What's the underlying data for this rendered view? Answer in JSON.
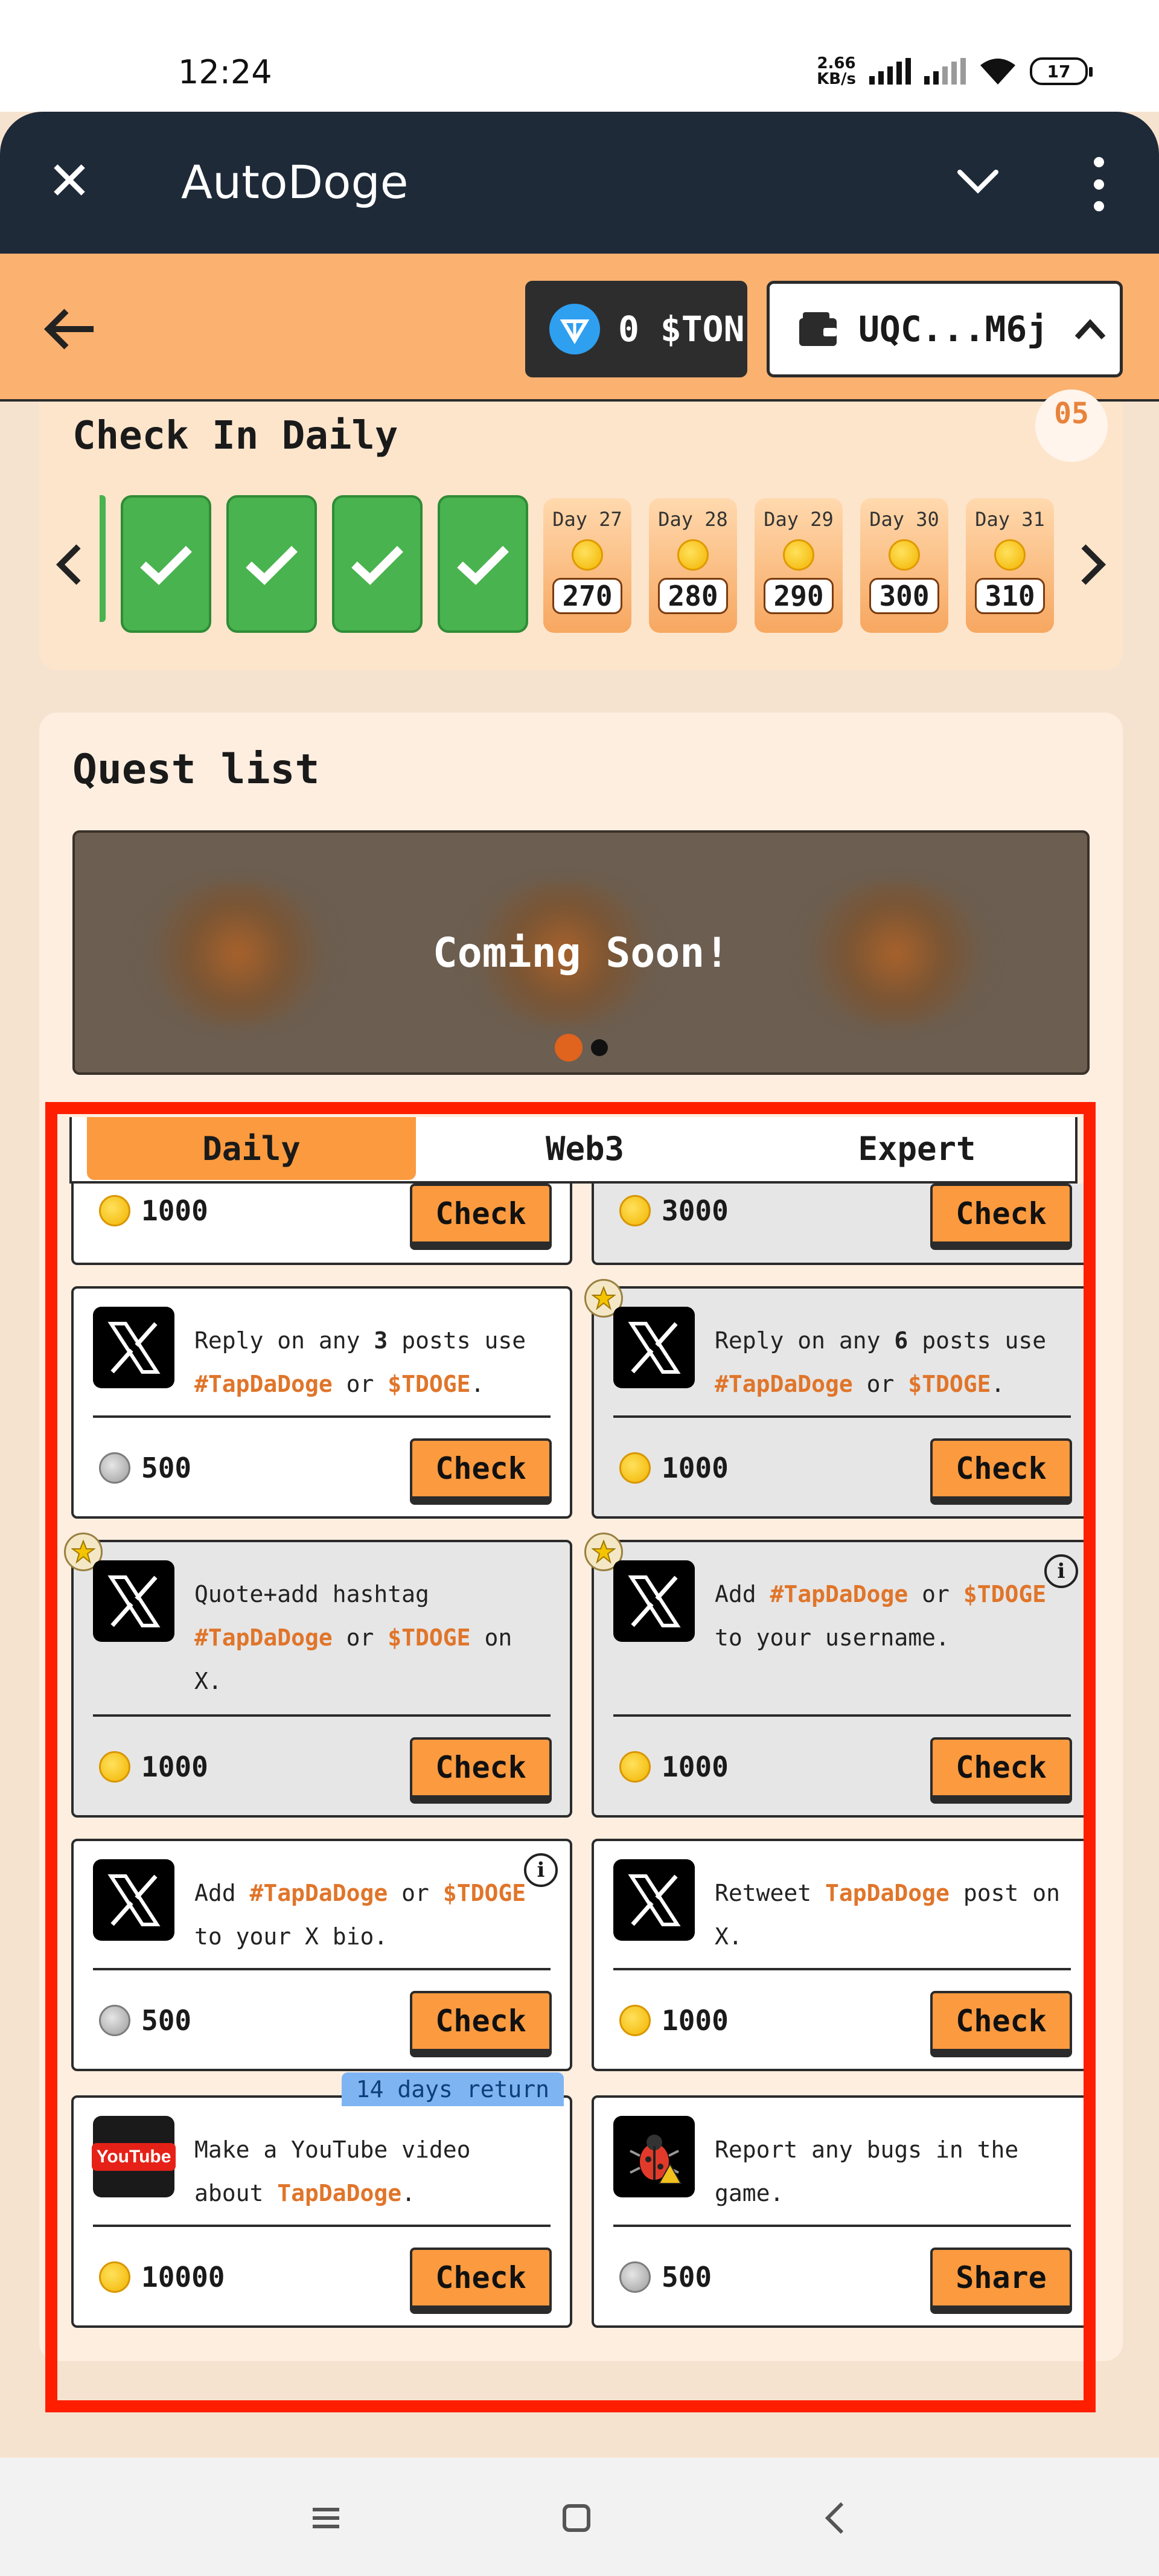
{
  "status": {
    "time": "12:24",
    "netspeed_top": "2.66",
    "netspeed_bottom": "KB/s",
    "battery": "17"
  },
  "app": {
    "title": "AutoDoge"
  },
  "header": {
    "ton_balance": "0 $TON",
    "wallet": "UQC...M6j"
  },
  "checkin": {
    "title": "Check In Daily",
    "bonus_badge": "05",
    "days": [
      {
        "label": "Day 27",
        "value": "270"
      },
      {
        "label": "Day 28",
        "value": "280"
      },
      {
        "label": "Day 29",
        "value": "290"
      },
      {
        "label": "Day 30",
        "value": "300"
      },
      {
        "label": "Day 31",
        "value": "310"
      }
    ]
  },
  "quests": {
    "title": "Quest list",
    "banner_text": "Coming Soon!",
    "tabs": [
      "Daily",
      "Web3",
      "Expert"
    ],
    "top_partial": [
      {
        "reward": "1000",
        "button": "Check"
      },
      {
        "reward": "3000",
        "button": "Check"
      }
    ],
    "cards": [
      {
        "text_before": "Reply on any ",
        "strong": "3",
        "text_mid": " posts use ",
        "tag1": "#TapDaDoge",
        "join": " or ",
        "tag2": "$TDOGE",
        "text_after": ".",
        "reward": "500",
        "button": "Check"
      },
      {
        "text_before": "Reply on any ",
        "strong": "6",
        "text_mid": " posts use ",
        "tag1": "#TapDaDoge",
        "join": " or ",
        "tag2": "$TDOGE",
        "text_after": ".",
        "reward": "1000",
        "button": "Check"
      },
      {
        "text_before": "Quote+add hashtag ",
        "tag1": "#TapDaDoge",
        "join": " or ",
        "tag2": "$TDOGE",
        "text_after": " on X.",
        "reward": "1000",
        "button": "Check"
      },
      {
        "text_before": "Add ",
        "tag1": "#TapDaDoge",
        "join": " or ",
        "tag2": "$TDOGE",
        "text_after": " to your username.",
        "reward": "1000",
        "button": "Check"
      },
      {
        "text_before": "Add ",
        "tag1": "#TapDaDoge",
        "join": " or ",
        "tag2": "$TDOGE",
        "text_after": " to your X bio.",
        "reward": "500",
        "button": "Check"
      },
      {
        "text_before": "Retweet ",
        "tag1": "TapDaDoge",
        "text_after": " post on X.",
        "reward": "1000",
        "button": "Check"
      },
      {
        "text_before": "Make a YouTube video about ",
        "tag1": "TapDaDoge",
        "text_after": ".",
        "reward": "10000",
        "button": "Check",
        "badge": "14 days return",
        "logo_text": "YouTube"
      },
      {
        "text_before": "Report any bugs in the game.",
        "reward": "500",
        "button": "Share"
      }
    ]
  }
}
